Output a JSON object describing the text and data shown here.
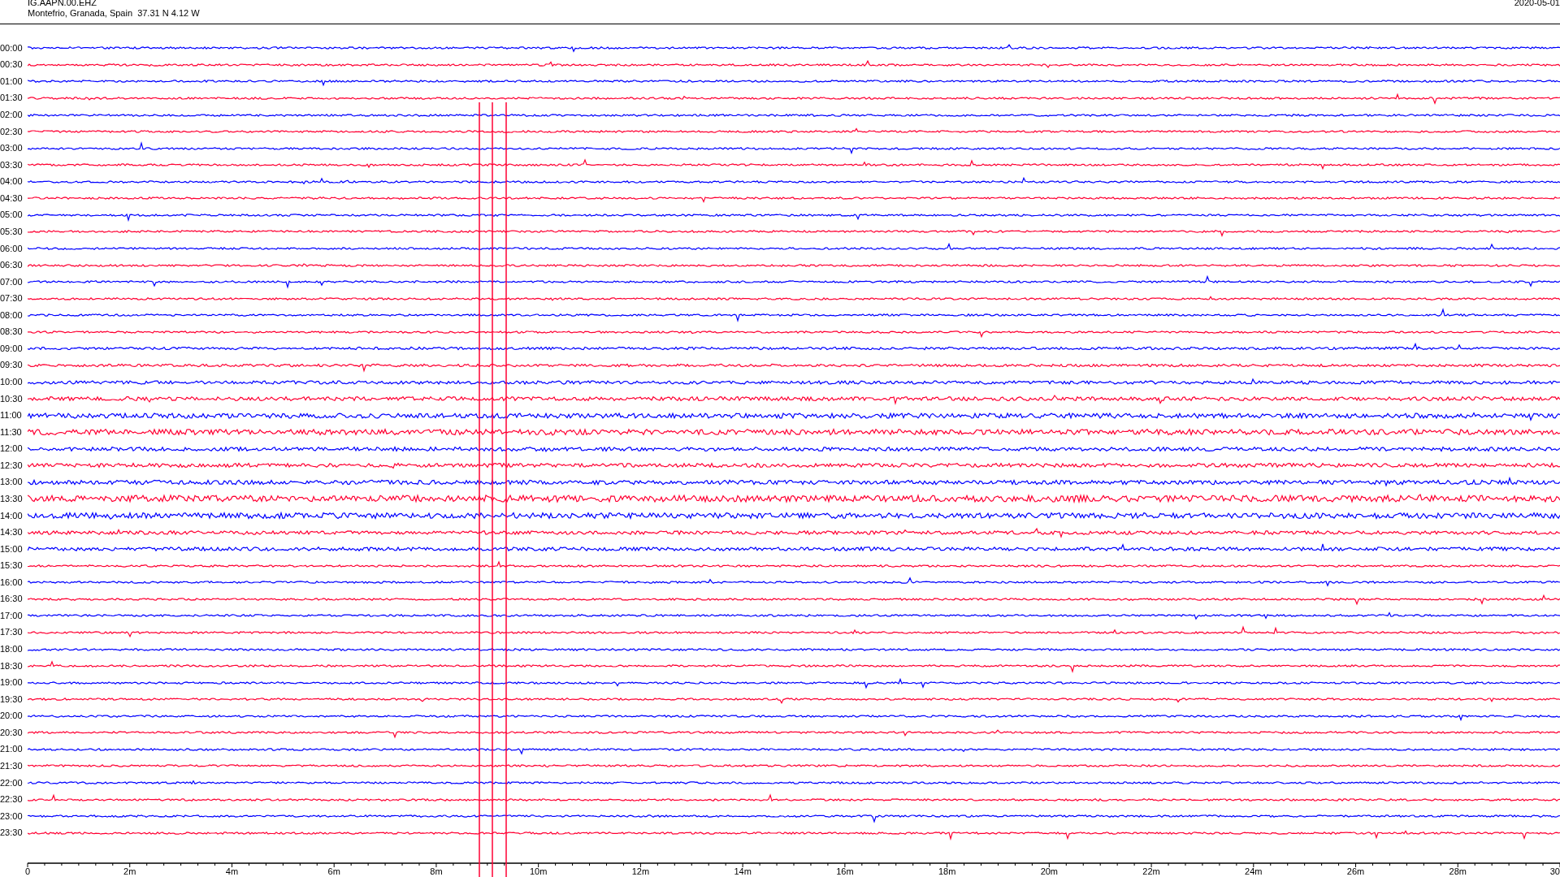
{
  "header": {
    "station": "IG.AAPN.00.EHZ",
    "location": "Montefrio, Granada, Spain  37.31 N 4.12 W",
    "date": "2020-05-01"
  },
  "rows": [
    {
      "label": "00:00",
      "color": "#0000ff"
    },
    {
      "label": "00:30",
      "color": "#ff0033"
    },
    {
      "label": "01:00",
      "color": "#0000ff"
    },
    {
      "label": "01:30",
      "color": "#ff0033"
    },
    {
      "label": "02:00",
      "color": "#0000ff"
    },
    {
      "label": "02:30",
      "color": "#ff0033"
    },
    {
      "label": "03:00",
      "color": "#0000ff"
    },
    {
      "label": "03:30",
      "color": "#ff0033"
    },
    {
      "label": "04:00",
      "color": "#0000ff"
    },
    {
      "label": "04:30",
      "color": "#ff0033"
    },
    {
      "label": "05:00",
      "color": "#0000ff"
    },
    {
      "label": "05:30",
      "color": "#ff0033"
    },
    {
      "label": "06:00",
      "color": "#0000ff"
    },
    {
      "label": "06:30",
      "color": "#ff0033"
    },
    {
      "label": "07:00",
      "color": "#0000ff"
    },
    {
      "label": "07:30",
      "color": "#ff0033"
    },
    {
      "label": "08:00",
      "color": "#0000ff"
    },
    {
      "label": "08:30",
      "color": "#ff0033"
    },
    {
      "label": "09:00",
      "color": "#0000ff"
    },
    {
      "label": "09:30",
      "color": "#ff0033"
    },
    {
      "label": "10:00",
      "color": "#0000ff"
    },
    {
      "label": "10:30",
      "color": "#ff0033"
    },
    {
      "label": "11:00",
      "color": "#0000ff"
    },
    {
      "label": "11:30",
      "color": "#ff0033"
    },
    {
      "label": "12:00",
      "color": "#0000ff"
    },
    {
      "label": "12:30",
      "color": "#ff0033"
    },
    {
      "label": "13:00",
      "color": "#0000ff"
    },
    {
      "label": "13:30",
      "color": "#ff0033"
    },
    {
      "label": "14:00",
      "color": "#0000ff"
    },
    {
      "label": "14:30",
      "color": "#ff0033"
    },
    {
      "label": "15:00",
      "color": "#0000ff"
    },
    {
      "label": "15:30",
      "color": "#ff0033"
    },
    {
      "label": "16:00",
      "color": "#0000ff"
    },
    {
      "label": "16:30",
      "color": "#ff0033"
    },
    {
      "label": "17:00",
      "color": "#0000ff"
    },
    {
      "label": "17:30",
      "color": "#ff0033"
    },
    {
      "label": "18:00",
      "color": "#0000ff"
    },
    {
      "label": "18:30",
      "color": "#ff0033"
    },
    {
      "label": "19:00",
      "color": "#0000ff"
    },
    {
      "label": "19:30",
      "color": "#ff0033"
    },
    {
      "label": "20:00",
      "color": "#0000ff"
    },
    {
      "label": "20:30",
      "color": "#ff0033"
    },
    {
      "label": "21:00",
      "color": "#0000ff"
    },
    {
      "label": "21:30",
      "color": "#ff0033"
    },
    {
      "label": "22:00",
      "color": "#0000ff"
    },
    {
      "label": "22:30",
      "color": "#ff0033"
    },
    {
      "label": "23:00",
      "color": "#0000ff"
    },
    {
      "label": "23:30",
      "color": "#ff0033"
    }
  ],
  "axis": {
    "ticks": [
      "0",
      "2m",
      "4m",
      "6m",
      "8m",
      "10m",
      "12m",
      "14m",
      "16m",
      "18m",
      "20m",
      "22m",
      "24m",
      "26m",
      "28m",
      "30"
    ]
  }
}
